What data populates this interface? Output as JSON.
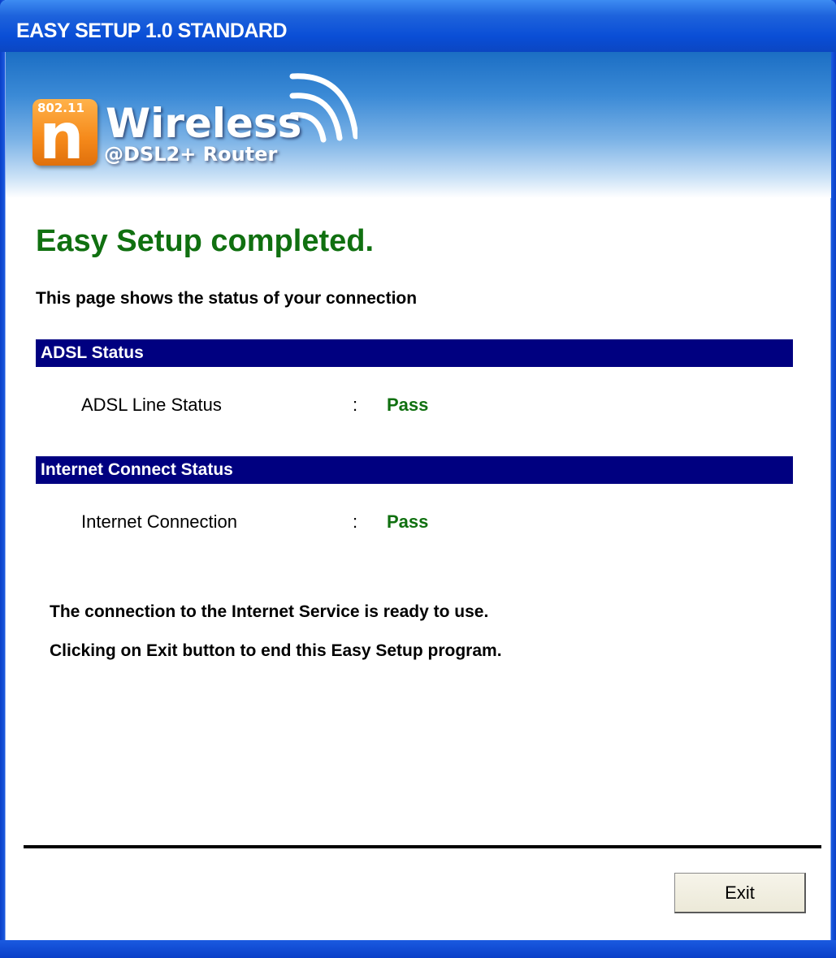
{
  "window": {
    "title": "EASY SETUP 1.0 STANDARD"
  },
  "logo": {
    "badge_small": "802.11",
    "badge_letter": "n",
    "title": "Wireless",
    "subtitle": "@DSL2+ Router"
  },
  "main": {
    "heading": "Easy Setup completed.",
    "intro": "This page shows the status of your connection",
    "sections": [
      {
        "header": "ADSL Status",
        "rows": [
          {
            "label": "ADSL Line Status",
            "separator": ":",
            "value": "Pass"
          }
        ]
      },
      {
        "header": "Internet Connect Status",
        "rows": [
          {
            "label": "Internet Connection",
            "separator": ":",
            "value": "Pass"
          }
        ]
      }
    ],
    "messages": [
      "The connection to the Internet Service is ready to use.",
      "Clicking on Exit button to end this Easy Setup program."
    ]
  },
  "footer": {
    "exit_label": "Exit"
  },
  "colors": {
    "titlebar": "#0a4ed6",
    "section_bar": "#000080",
    "success_green": "#107010",
    "logo_orange": "#f5891a"
  },
  "icons": {
    "logo_waves": "wireless-signal-icon"
  }
}
